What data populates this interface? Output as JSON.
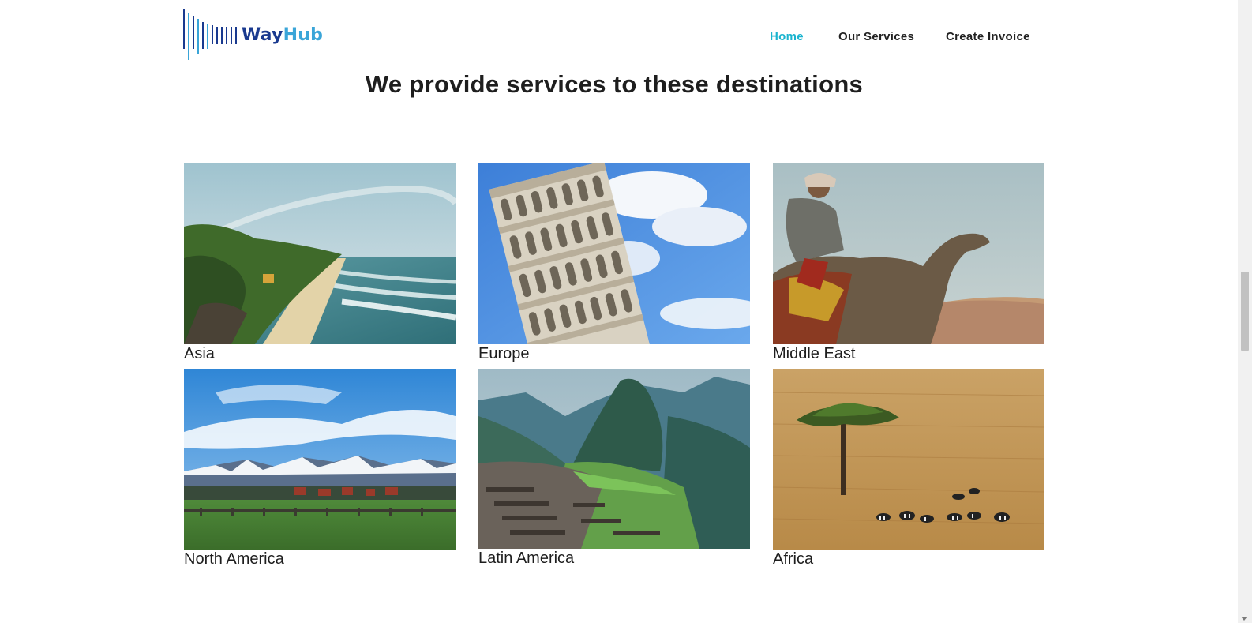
{
  "header": {
    "logo": {
      "part1": "Way",
      "part2": "Hub"
    },
    "nav": [
      {
        "label": "Home",
        "active": true
      },
      {
        "label": "Our Services",
        "active": false
      },
      {
        "label": "Create Invoice",
        "active": false
      }
    ]
  },
  "colors": {
    "accent": "#1bb4cf",
    "logo_dark": "#1a3a8f",
    "logo_light": "#3aa5d8",
    "text": "#1e1e1e"
  },
  "main": {
    "title": "We provide services to these destinations",
    "destinations": [
      {
        "label": "Asia",
        "image": "tropical-beach-cliffs-photo"
      },
      {
        "label": "Europe",
        "image": "leaning-tower-of-pisa-photo"
      },
      {
        "label": "Middle East",
        "image": "camel-rider-desert-photo"
      },
      {
        "label": "North America",
        "image": "snowy-mountains-meadow-photo"
      },
      {
        "label": "Latin America",
        "image": "machu-picchu-ruins-photo"
      },
      {
        "label": "Africa",
        "image": "savanna-acacia-zebras-photo"
      }
    ]
  }
}
